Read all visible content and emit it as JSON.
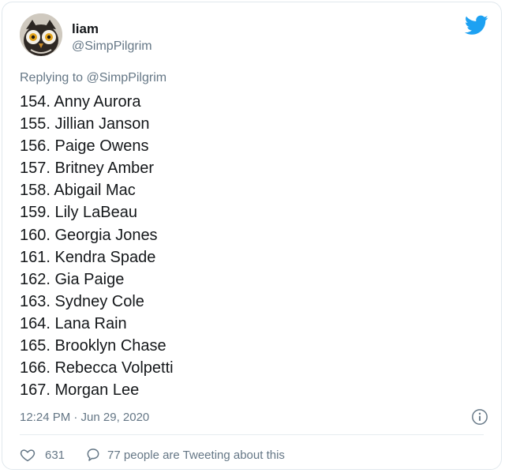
{
  "tweet": {
    "author": {
      "display_name": "liam",
      "handle": "@SimpPilgrim",
      "avatar_icon": "owl-avatar"
    },
    "platform_icon": "twitter-bird-icon",
    "replying_prefix": "Replying to",
    "replying_to": "@SimpPilgrim",
    "lines": [
      "154. Anny Aurora",
      "155. Jillian Janson",
      "156. Paige Owens",
      "157. Britney Amber",
      "158. Abigail Mac",
      "159. Lily LaBeau",
      "160. Georgia Jones",
      "161. Kendra Spade",
      "162. Gia Paige",
      "163. Sydney Cole",
      "164. Lana Rain",
      "165. Brooklyn Chase",
      "166. Rebecca Volpetti",
      "167. Morgan Lee"
    ],
    "timestamp": "12:24 PM · Jun 29, 2020",
    "likes": "631",
    "conversation_text": "77 people are Tweeting about this"
  },
  "colors": {
    "brand_blue": "#1da1f2",
    "secondary_text": "#657786",
    "primary_text": "#14171a",
    "border": "#e1e8ed"
  }
}
